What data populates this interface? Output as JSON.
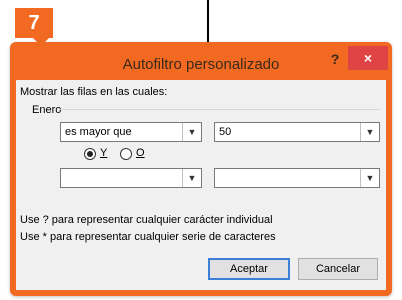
{
  "step": "7",
  "dialog": {
    "title": "Autofiltro personalizado",
    "help_label": "?",
    "close_label": "×",
    "show_rows_label": "Mostrar las filas en las cuales:",
    "field_name": "Enero",
    "condition1": {
      "operator": "es mayor que",
      "value": "50"
    },
    "logic": {
      "and_label": "Y",
      "or_label": "O",
      "selected": "Y"
    },
    "condition2": {
      "operator": "",
      "value": ""
    },
    "hint1": "Use ? para representar cualquier carácter individual",
    "hint2": "Use * para representar cualquier serie de caracteres",
    "ok_label": "Aceptar",
    "cancel_label": "Cancelar"
  },
  "colors": {
    "accent": "#f26a22",
    "close": "#e04343",
    "client": "#f0f0f0",
    "focus": "#3c7fd8"
  }
}
